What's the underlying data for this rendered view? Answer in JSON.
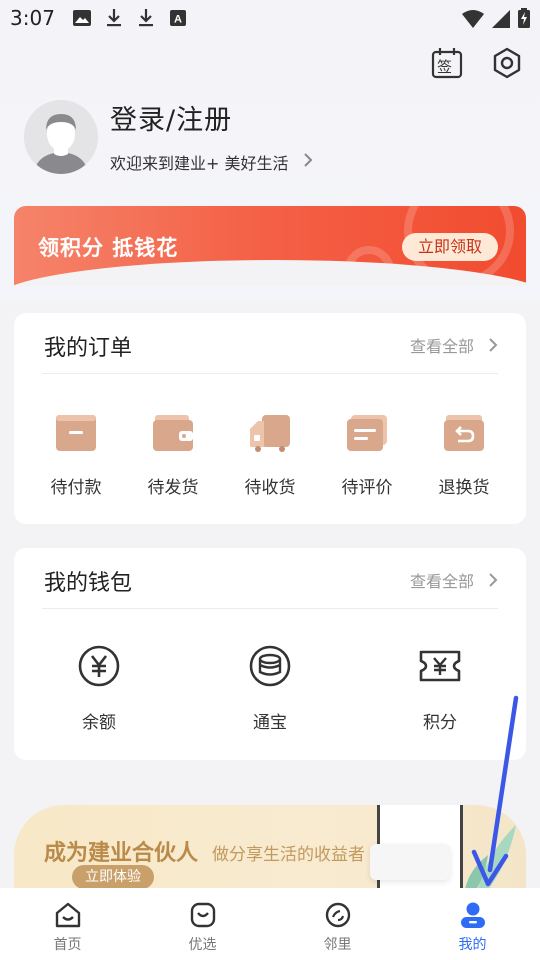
{
  "status_bar": {
    "time": "3:07",
    "icons": [
      "image-icon",
      "download-icon",
      "download-icon",
      "font-icon"
    ],
    "right_icons": [
      "wifi-icon",
      "signal-icon",
      "battery-charging-icon"
    ]
  },
  "header": {
    "sign_icon_label": "签",
    "icons": [
      "sign-in-calendar-icon",
      "settings-hexagon-icon"
    ]
  },
  "profile": {
    "title": "登录/注册",
    "welcome": "欢迎来到建业+ 美好生活"
  },
  "points_banner": {
    "text": "领积分 抵钱花",
    "button": "立即领取",
    "colors": {
      "start": "#f5846a",
      "end": "#f24b2f",
      "button_bg": "#fde9d5"
    }
  },
  "orders": {
    "title": "我的订单",
    "view_all": "查看全部",
    "items": [
      {
        "label": "待付款",
        "icon": "pending-payment-icon"
      },
      {
        "label": "待发货",
        "icon": "wallet-ship-icon"
      },
      {
        "label": "待收货",
        "icon": "delivery-truck-icon"
      },
      {
        "label": "待评价",
        "icon": "review-icon"
      },
      {
        "label": "退换货",
        "icon": "return-icon"
      }
    ]
  },
  "wallet": {
    "title": "我的钱包",
    "view_all": "查看全部",
    "items": [
      {
        "label": "余额",
        "icon": "yen-circle-icon"
      },
      {
        "label": "通宝",
        "icon": "coin-stack-icon"
      },
      {
        "label": "积分",
        "icon": "yen-ticket-icon"
      }
    ]
  },
  "partner_banner": {
    "title": "成为建业合伙人",
    "subtitle": "做分享生活的收益者",
    "button": "立即体验"
  },
  "bottom_nav": {
    "items": [
      {
        "label": "首页",
        "icon": "home-icon",
        "active": false
      },
      {
        "label": "优选",
        "icon": "shopping-bag-icon",
        "active": false
      },
      {
        "label": "邻里",
        "icon": "neighborhood-icon",
        "active": false
      },
      {
        "label": "我的",
        "icon": "profile-icon",
        "active": true
      }
    ],
    "active_color": "#2f6cf6"
  }
}
